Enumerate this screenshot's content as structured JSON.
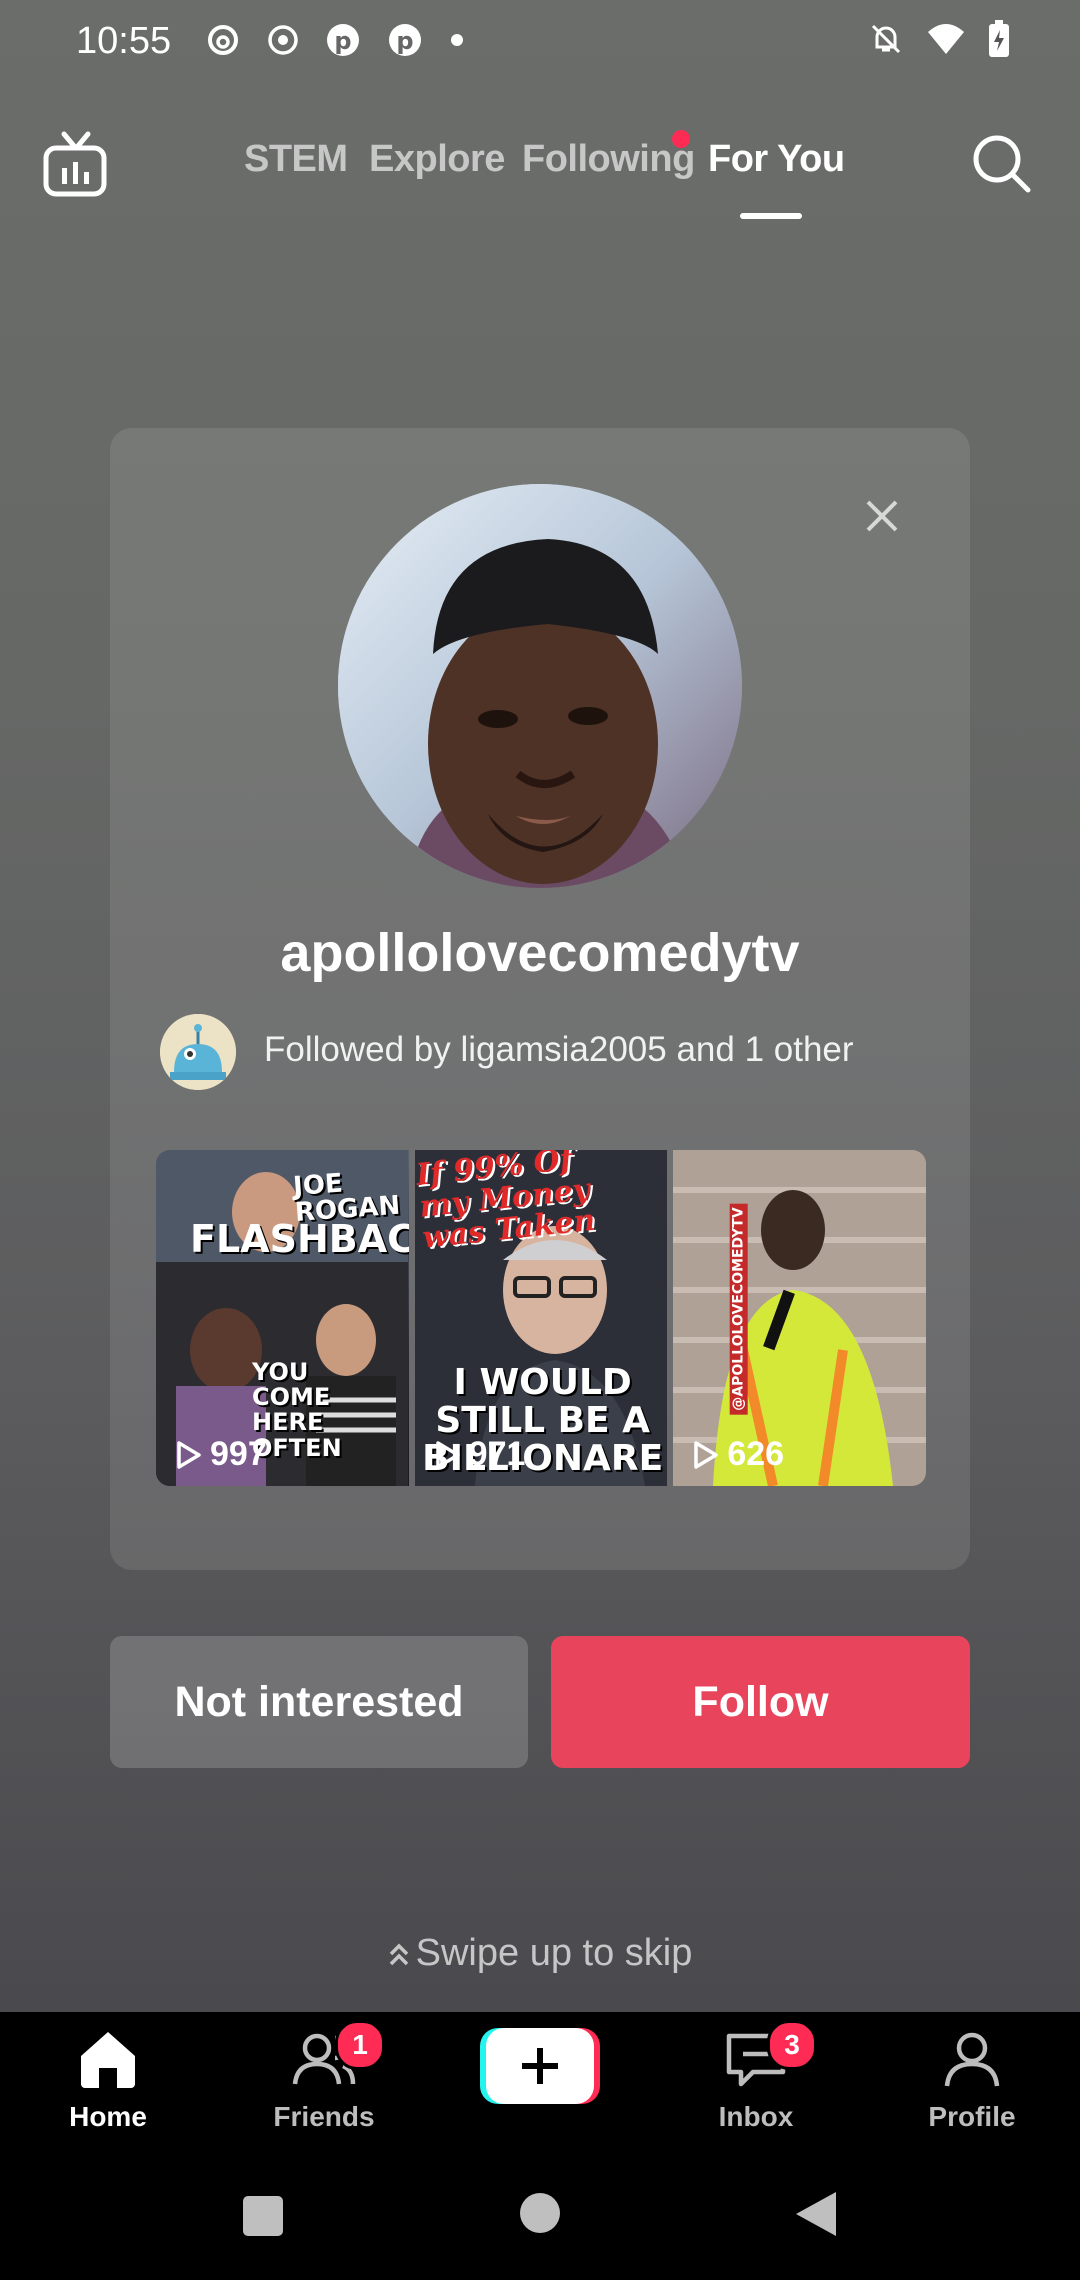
{
  "status_bar": {
    "time": "10:55",
    "left_icons": [
      "threads-icon",
      "record-icon",
      "pinterest-icon",
      "pinterest-icon",
      "dot-icon"
    ],
    "right_icons": [
      "mute-icon",
      "wifi-icon",
      "battery-charging-icon"
    ]
  },
  "top_nav": {
    "tabs": [
      {
        "label": "STEM"
      },
      {
        "label": "Explore"
      },
      {
        "label": "Following"
      },
      {
        "label": "For You"
      }
    ],
    "active_tab": "For You"
  },
  "suggestion": {
    "username": "apollolovecomedytv",
    "followed_by": "Followed by ligamsia2005 and 1 other",
    "videos": [
      {
        "overlay_top": "JOE ROGAN",
        "overlay_mid": "FLASHBACK",
        "overlay_bottom": "YOU COME HERE OFTEN",
        "views": "997"
      },
      {
        "overlay_top": "If 99% Of my Money was Taken",
        "overlay_bottom": "I WOULD STILL BE A BILLIONARE",
        "views": "971"
      },
      {
        "overlay_side": "@APOLLOLOVECOMEDYTV",
        "views": "626"
      }
    ]
  },
  "actions": {
    "not_interested": "Not interested",
    "follow": "Follow"
  },
  "swipe_hint": "Swipe up to skip",
  "bottom_nav": {
    "items": [
      {
        "label": "Home"
      },
      {
        "label": "Friends",
        "badge": "1"
      },
      {
        "label": "Inbox",
        "badge": "3"
      },
      {
        "label": "Profile"
      }
    ]
  },
  "colors": {
    "accent": "#fe2c55",
    "follow_button": "#e8445c"
  }
}
